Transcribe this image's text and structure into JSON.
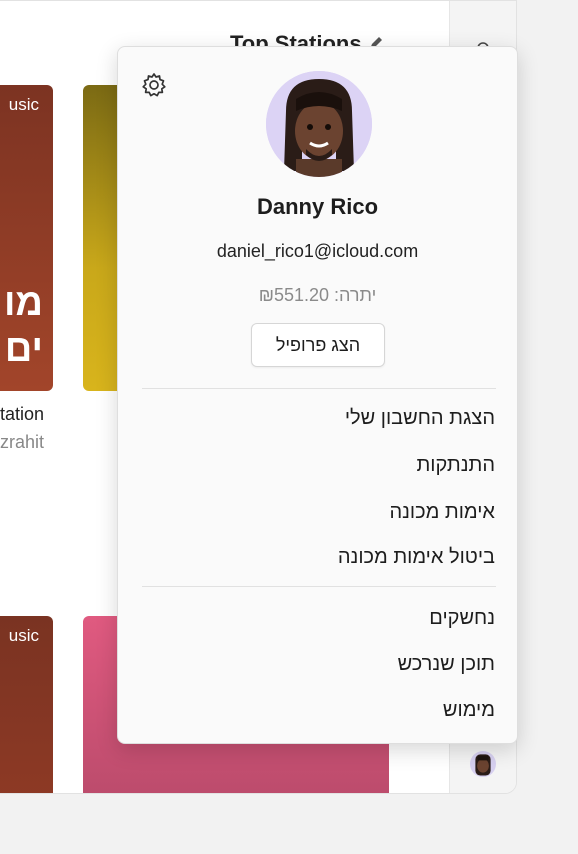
{
  "background": {
    "section_title": "Top Stations",
    "cards": {
      "card1_tag": "usic",
      "card1_big_line1": "מו",
      "card1_big_line2": "ים",
      "card3_tag": "usic"
    },
    "caption": {
      "title": "tation",
      "subtitle": "zrahit"
    }
  },
  "account_menu": {
    "settings_icon": "gear-icon",
    "user_name": "Danny Rico",
    "email": "daniel_rico1@icloud.com",
    "balance": "יתרה: ₪551.20",
    "view_profile_label": "הצג פרופיל",
    "items_group1": [
      "הצגת החשבון שלי",
      "התנתקות",
      "אימות מכונה",
      "ביטול אימות מכונה"
    ],
    "items_group2": [
      "נחשקים",
      "תוכן שנרכש",
      "מימוש"
    ]
  },
  "colors": {
    "popup_bg": "#fafafa",
    "avatar_bg": "#dcd3f5"
  }
}
